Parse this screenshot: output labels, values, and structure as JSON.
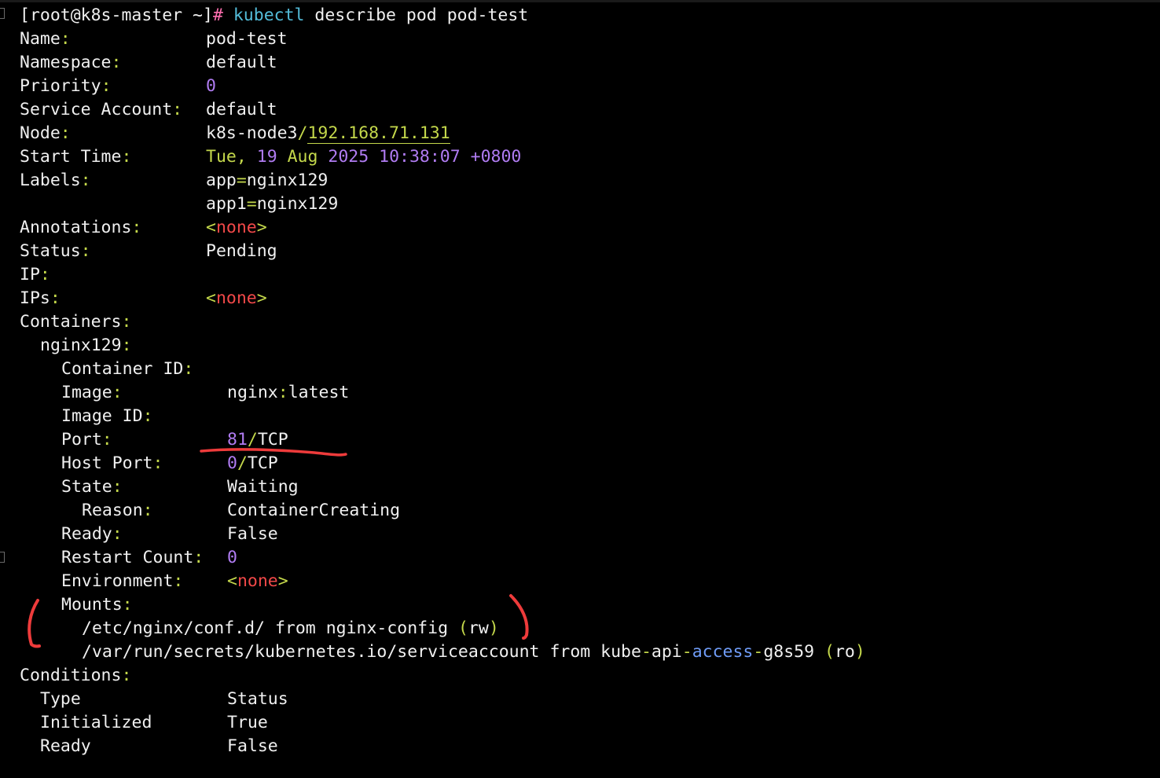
{
  "prompt": {
    "user_host": "[root@k8s-master ~]",
    "hash": "#",
    "command": "kubectl",
    "args": "describe pod pod-test"
  },
  "pod": {
    "name_label": "Name",
    "name": "pod-test",
    "namespace_label": "Namespace",
    "namespace": "default",
    "priority_label": "Priority",
    "priority": "0",
    "service_account_label": "Service Account",
    "service_account": "default",
    "node_label": "Node",
    "node_name": "k8s-node3",
    "node_ip": "192.168.71.131",
    "start_time_label": "Start Time",
    "start_day": "Tue",
    "start_date_num": "19",
    "start_month": "Aug",
    "start_year": "2025",
    "start_time": "10:38:07",
    "start_tz": "+0800",
    "labels_label": "Labels",
    "labels": [
      {
        "key": "app",
        "value": "nginx129"
      },
      {
        "key": "app1",
        "value": "nginx129"
      }
    ],
    "annotations_label": "Annotations",
    "none_text": "none",
    "status_label": "Status",
    "status": "Pending",
    "ip_label": "IP",
    "ips_label": "IPs"
  },
  "containers": {
    "label": "Containers",
    "container_name": "nginx129",
    "container_id_label": "Container ID",
    "image_label": "Image",
    "image_name": "nginx",
    "image_tag": "latest",
    "image_id_label": "Image ID",
    "port_label": "Port",
    "port_num": "81",
    "port_proto": "TCP",
    "host_port_label": "Host Port",
    "host_port_num": "0",
    "host_port_proto": "TCP",
    "state_label": "State",
    "state": "Waiting",
    "reason_label": "Reason",
    "reason": "ContainerCreating",
    "ready_label": "Ready",
    "ready": "False",
    "restart_count_label": "Restart Count",
    "restart_count": "0",
    "environment_label": "Environment",
    "mounts_label": "Mounts",
    "mounts": [
      {
        "path": "/etc/nginx/conf.d/",
        "from": "from",
        "source": "nginx-config",
        "mode": "rw"
      },
      {
        "path": "/var/run/secrets/kubernetes.io/serviceaccount",
        "from": "from",
        "source_a": "kube",
        "source_b": "api",
        "source_c": "access",
        "source_d": "g8s59",
        "mode": "ro"
      }
    ]
  },
  "conditions": {
    "label": "Conditions",
    "col_type": "Type",
    "col_status": "Status",
    "rows": [
      {
        "type": "Initialized",
        "status": "True"
      },
      {
        "type": "Ready",
        "status": "False"
      }
    ]
  },
  "colors": {
    "background": "#000000",
    "text": "#f0f0f0",
    "punctuation": "#c4d84b",
    "number": "#b07cf2",
    "command": "#53bcd9",
    "none": "#f14848",
    "annotation_ink": "#ee3b3b"
  }
}
